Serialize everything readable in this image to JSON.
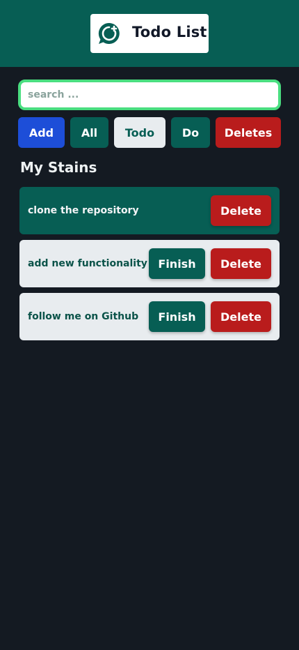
{
  "header": {
    "title": "Todo List",
    "logo_icon": "chat-plus-icon"
  },
  "search": {
    "placeholder": "search ..."
  },
  "filters": {
    "add_label": "Add",
    "all_label": "All",
    "todo_label": "Todo",
    "do_label": "Do",
    "deletes_label": "Deletes"
  },
  "section": {
    "title": "My Stains"
  },
  "todos": [
    {
      "text": "clone the repository",
      "status": "done",
      "delete_label": "Delete"
    },
    {
      "text": "add new functionality",
      "status": "pending",
      "finish_label": "Finish",
      "delete_label": "Delete"
    },
    {
      "text": "follow me on Github",
      "status": "pending",
      "finish_label": "Finish",
      "delete_label": "Delete"
    }
  ],
  "colors": {
    "primary": "#075e54",
    "background": "#141a22",
    "accent_blue": "#1d4ed8",
    "danger": "#b91c1c",
    "focus_ring": "#4ade80"
  }
}
